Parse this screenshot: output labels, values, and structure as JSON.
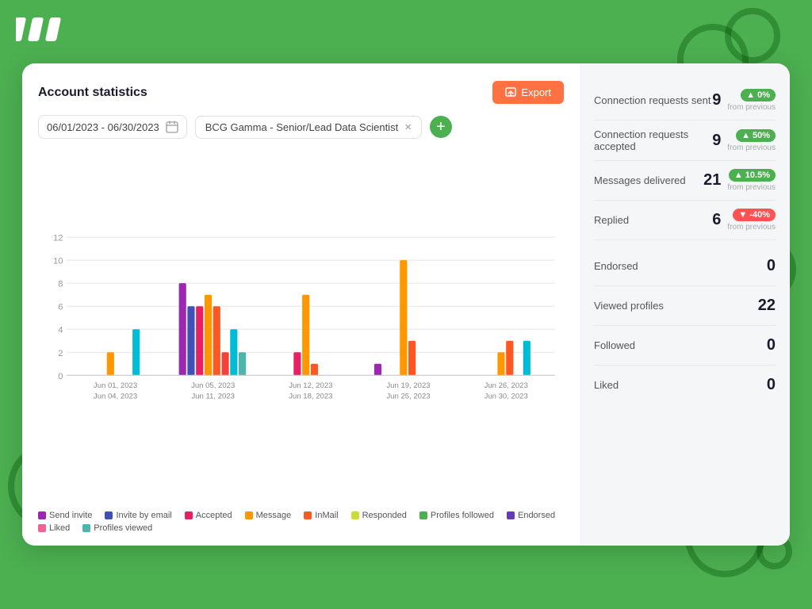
{
  "app": {
    "title": "Account statistics"
  },
  "header": {
    "export_label": "Export"
  },
  "filters": {
    "date_range": "06/01/2023 - 06/30/2023",
    "tag_label": "BCG Gamma - Senior/Lead Data Scientist"
  },
  "chart": {
    "y_max": 12,
    "y_labels": [
      "0",
      "2",
      "4",
      "6",
      "8",
      "10",
      "12"
    ],
    "x_groups": [
      {
        "label": "Jun 01, 2023 - Jun 04, 2023",
        "bars": [
          {
            "color": "#9c27b0",
            "h": 0
          },
          {
            "color": "#3f51b5",
            "h": 0
          },
          {
            "color": "#e91e63",
            "h": 0
          },
          {
            "color": "#ff9800",
            "h": 2
          },
          {
            "color": "#ff5722",
            "h": 0
          },
          {
            "color": "#f44336",
            "h": 0
          },
          {
            "color": "#00bcd4",
            "h": 4
          },
          {
            "color": "#4db6ac",
            "h": 0
          }
        ]
      },
      {
        "label": "Jun 05, 2023 - Jun 11, 2023",
        "bars": [
          {
            "color": "#9c27b0",
            "h": 8
          },
          {
            "color": "#3f51b5",
            "h": 6
          },
          {
            "color": "#e91e63",
            "h": 6
          },
          {
            "color": "#ff9800",
            "h": 7
          },
          {
            "color": "#ff5722",
            "h": 6
          },
          {
            "color": "#f44336",
            "h": 2
          },
          {
            "color": "#00bcd4",
            "h": 4
          },
          {
            "color": "#4db6ac",
            "h": 2
          }
        ]
      },
      {
        "label": "Jun 12, 2023 - Jun 18, 2023",
        "bars": [
          {
            "color": "#9c27b0",
            "h": 0
          },
          {
            "color": "#3f51b5",
            "h": 0
          },
          {
            "color": "#e91e63",
            "h": 2
          },
          {
            "color": "#ff9800",
            "h": 7
          },
          {
            "color": "#ff5722",
            "h": 1
          },
          {
            "color": "#f44336",
            "h": 0
          },
          {
            "color": "#00bcd4",
            "h": 0
          },
          {
            "color": "#4db6ac",
            "h": 0
          }
        ]
      },
      {
        "label": "Jun 19, 2023 - Jun 25, 2023",
        "bars": [
          {
            "color": "#9c27b0",
            "h": 1
          },
          {
            "color": "#3f51b5",
            "h": 0
          },
          {
            "color": "#e91e63",
            "h": 0
          },
          {
            "color": "#ff9800",
            "h": 10
          },
          {
            "color": "#ff5722",
            "h": 3
          },
          {
            "color": "#f44336",
            "h": 0
          },
          {
            "color": "#00bcd4",
            "h": 0
          },
          {
            "color": "#4db6ac",
            "h": 0
          }
        ]
      },
      {
        "label": "Jun 26, 2023 - Jun 30, 2023",
        "bars": [
          {
            "color": "#9c27b0",
            "h": 0
          },
          {
            "color": "#3f51b5",
            "h": 0
          },
          {
            "color": "#e91e63",
            "h": 0
          },
          {
            "color": "#ff9800",
            "h": 2
          },
          {
            "color": "#ff5722",
            "h": 3
          },
          {
            "color": "#f44336",
            "h": 0
          },
          {
            "color": "#00bcd4",
            "h": 3
          },
          {
            "color": "#4db6ac",
            "h": 0
          }
        ]
      }
    ]
  },
  "legend": [
    {
      "label": "Send invite",
      "color": "#9c27b0"
    },
    {
      "label": "Invite by email",
      "color": "#3f51b5"
    },
    {
      "label": "Accepted",
      "color": "#e91e63"
    },
    {
      "label": "Message",
      "color": "#ff9800"
    },
    {
      "label": "InMail",
      "color": "#ff5722"
    },
    {
      "label": "Responded",
      "color": "#cddc39"
    },
    {
      "label": "Profiles followed",
      "color": "#4caf50"
    },
    {
      "label": "Endorsed",
      "color": "#673ab7"
    },
    {
      "label": "Liked",
      "color": "#f06292"
    },
    {
      "label": "Profiles viewed",
      "color": "#4db6ac"
    }
  ],
  "stats": {
    "connection_requests_sent": {
      "label": "Connection requests sent",
      "value": "9",
      "badge": "0%",
      "badge_type": "green",
      "from_prev": "from previous"
    },
    "connection_requests_accepted": {
      "label": "Connection requests accepted",
      "value": "9",
      "badge": "50%",
      "badge_type": "green",
      "from_prev": "from previous"
    },
    "messages_delivered": {
      "label": "Messages delivered",
      "value": "21",
      "badge": "10.5%",
      "badge_type": "green",
      "from_prev": "from previous"
    },
    "replied": {
      "label": "Replied",
      "value": "6",
      "badge": "-40%",
      "badge_type": "red",
      "from_prev": "from previous"
    },
    "endorsed": {
      "label": "Endorsed",
      "value": "0"
    },
    "viewed_profiles": {
      "label": "Viewed profiles",
      "value": "22"
    },
    "followed": {
      "label": "Followed",
      "value": "0"
    },
    "liked": {
      "label": "Liked",
      "value": "0"
    }
  }
}
